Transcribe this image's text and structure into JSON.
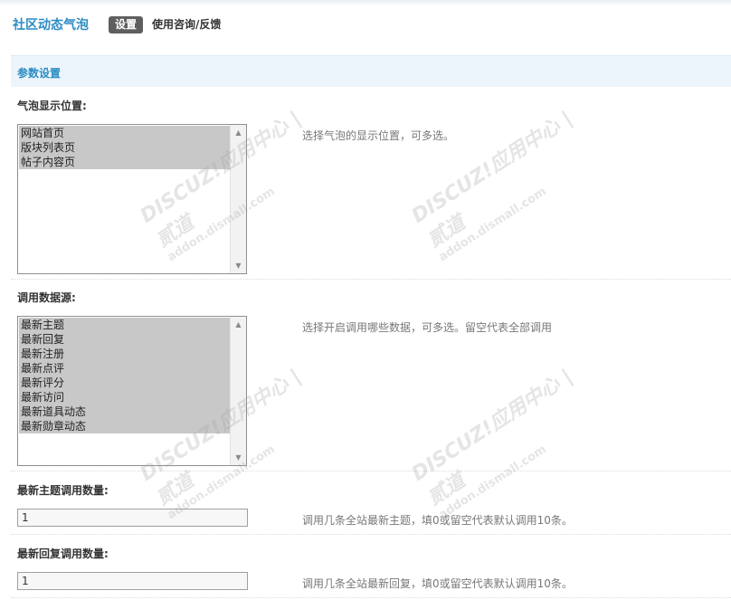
{
  "header": {
    "app_title": "社区动态气泡",
    "tabs": [
      {
        "label": "设置"
      },
      {
        "label": "使用咨询/反馈"
      }
    ]
  },
  "section": {
    "title": "参数设置"
  },
  "fields": {
    "bubble_position": {
      "label": "气泡显示位置:",
      "options": [
        "网站首页",
        "版块列表页",
        "帖子内容页"
      ],
      "hint": "选择气泡的显示位置，可多选。"
    },
    "data_source": {
      "label": "调用数据源:",
      "options": [
        "最新主题",
        "最新回复",
        "最新注册",
        "最新点评",
        "最新评分",
        "最新访问",
        "最新道具动态",
        "最新勋章动态"
      ],
      "hint": "选择开启调用哪些数据，可多选。留空代表全部调用"
    },
    "thread_count": {
      "label": "最新主题调用数量:",
      "value": "1",
      "hint": "调用几条全站最新主题，填0或留空代表默认调用10条。"
    },
    "reply_count": {
      "label": "最新回复调用数量:",
      "value": "1",
      "hint": "调用几条全站最新回复，填0或留空代表默认调用10条。"
    }
  },
  "watermark": {
    "logo": "DISCUZ!应用中心 | 贰道",
    "url": "addon.dismall.com"
  },
  "colors": {
    "accent": "#2b8cc4",
    "section_bg": "#ecf5fb",
    "selected_option": "#c8c8c8",
    "active_tab": "#5f5f5f"
  }
}
